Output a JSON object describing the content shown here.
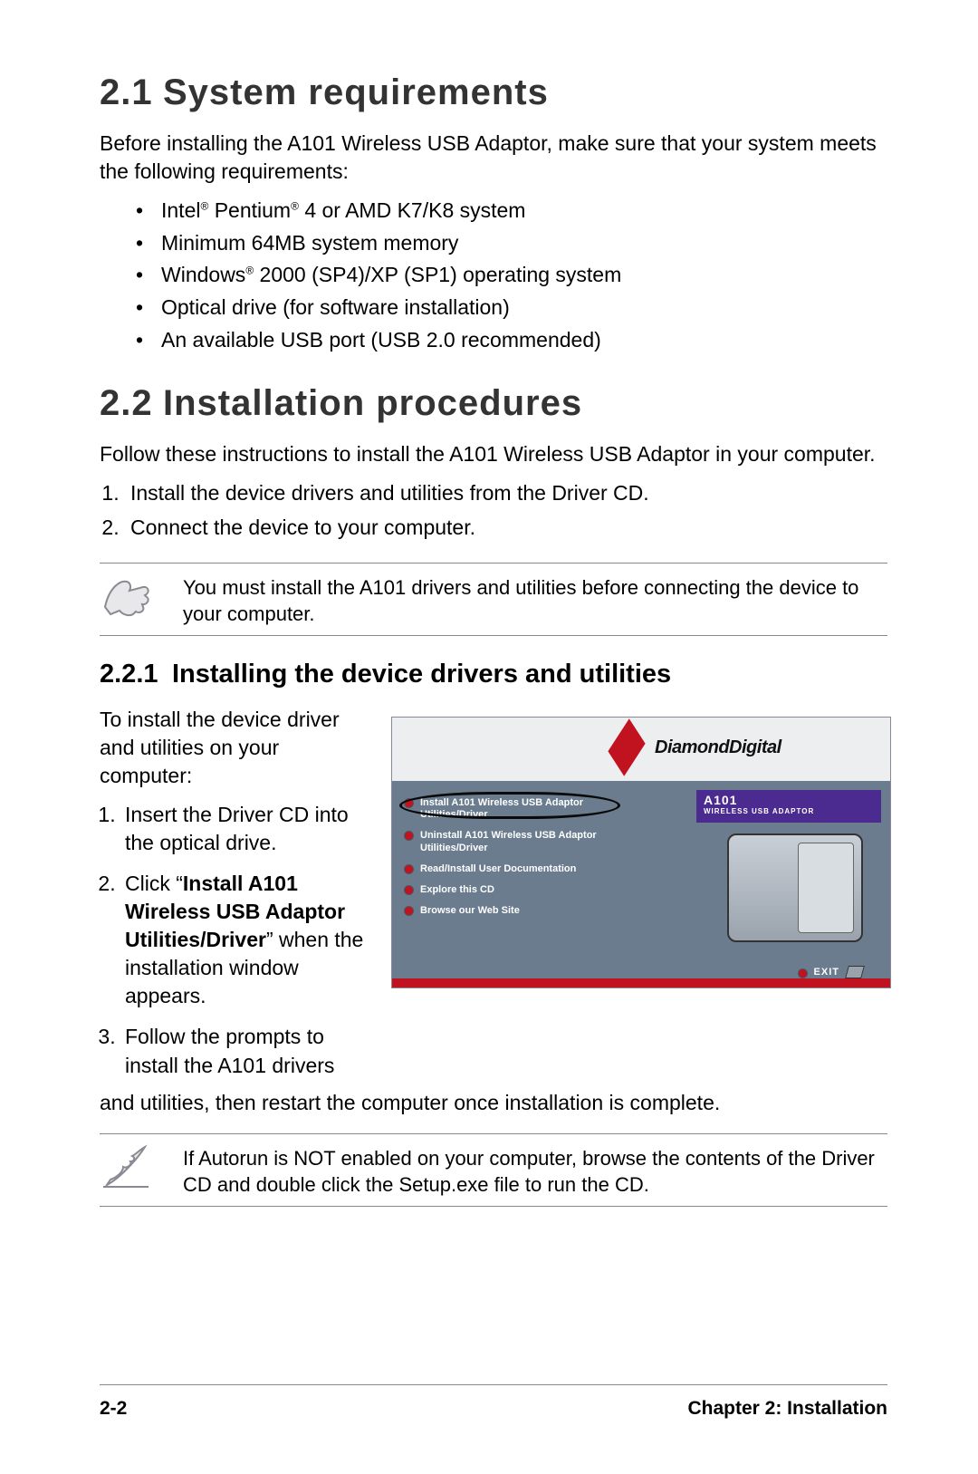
{
  "section21": {
    "num": "2.1",
    "title": "System requirements",
    "intro": "Before installing the A101 Wireless USB  Adaptor, make sure that your system meets the following requirements:",
    "reqs": {
      "r1a": "Intel",
      "r1b": " Pentium",
      "r1c": " 4 or AMD K7/K8 system",
      "r2": "Minimum 64MB system memory",
      "r3a": "Windows",
      "r3b": " 2000 (SP4)/XP (SP1) operating system",
      "r4": "Optical drive (for software installation)",
      "r5": "An available USB port (USB 2.0 recommended)"
    }
  },
  "section22": {
    "num": "2.2",
    "title": "Installation procedures",
    "intro": "Follow these instructions to install the A101 Wireless USB  Adaptor in your computer.",
    "steps": {
      "s1": "Install the device drivers and utilities from the Driver CD.",
      "s2": "Connect the device to your computer."
    },
    "note": "You must install the A101 drivers and utilities before connecting the device to your computer."
  },
  "section221": {
    "num": "2.2.1",
    "title": "Installing the device drivers and utilities",
    "intro": "To install the device driver and utilities on your computer:",
    "steps": {
      "s1": "Insert the Driver CD into the optical drive.",
      "s2a": "Click “",
      "s2b": "Install A101 Wireless USB Adaptor Utilities/Driver",
      "s2c": "” when the installation window appears.",
      "s3a": "Follow  the prompts to install the A101 drivers",
      "s3b": "and utilities, then restart the computer once installation is complete."
    },
    "note": "If Autorun is NOT enabled on your computer, browse the contents of the Driver CD and double click the Setup.exe file to run the CD."
  },
  "installer": {
    "brand": "DiamondDigital",
    "model": "A101",
    "subtitle": "WIRELESS USB ADAPTOR",
    "menu": {
      "m1": "Install A101 Wireless USB Adaptor Utilities/Driver",
      "m2": "Uninstall A101 Wireless USB Adaptor Utilities/Driver",
      "m3": "Read/Install User Documentation",
      "m4": "Explore this CD",
      "m5": "Browse our Web Site"
    },
    "exit": "EXIT"
  },
  "footer": {
    "left": "2-2",
    "right": "Chapter 2: Installation"
  },
  "reg": "®"
}
